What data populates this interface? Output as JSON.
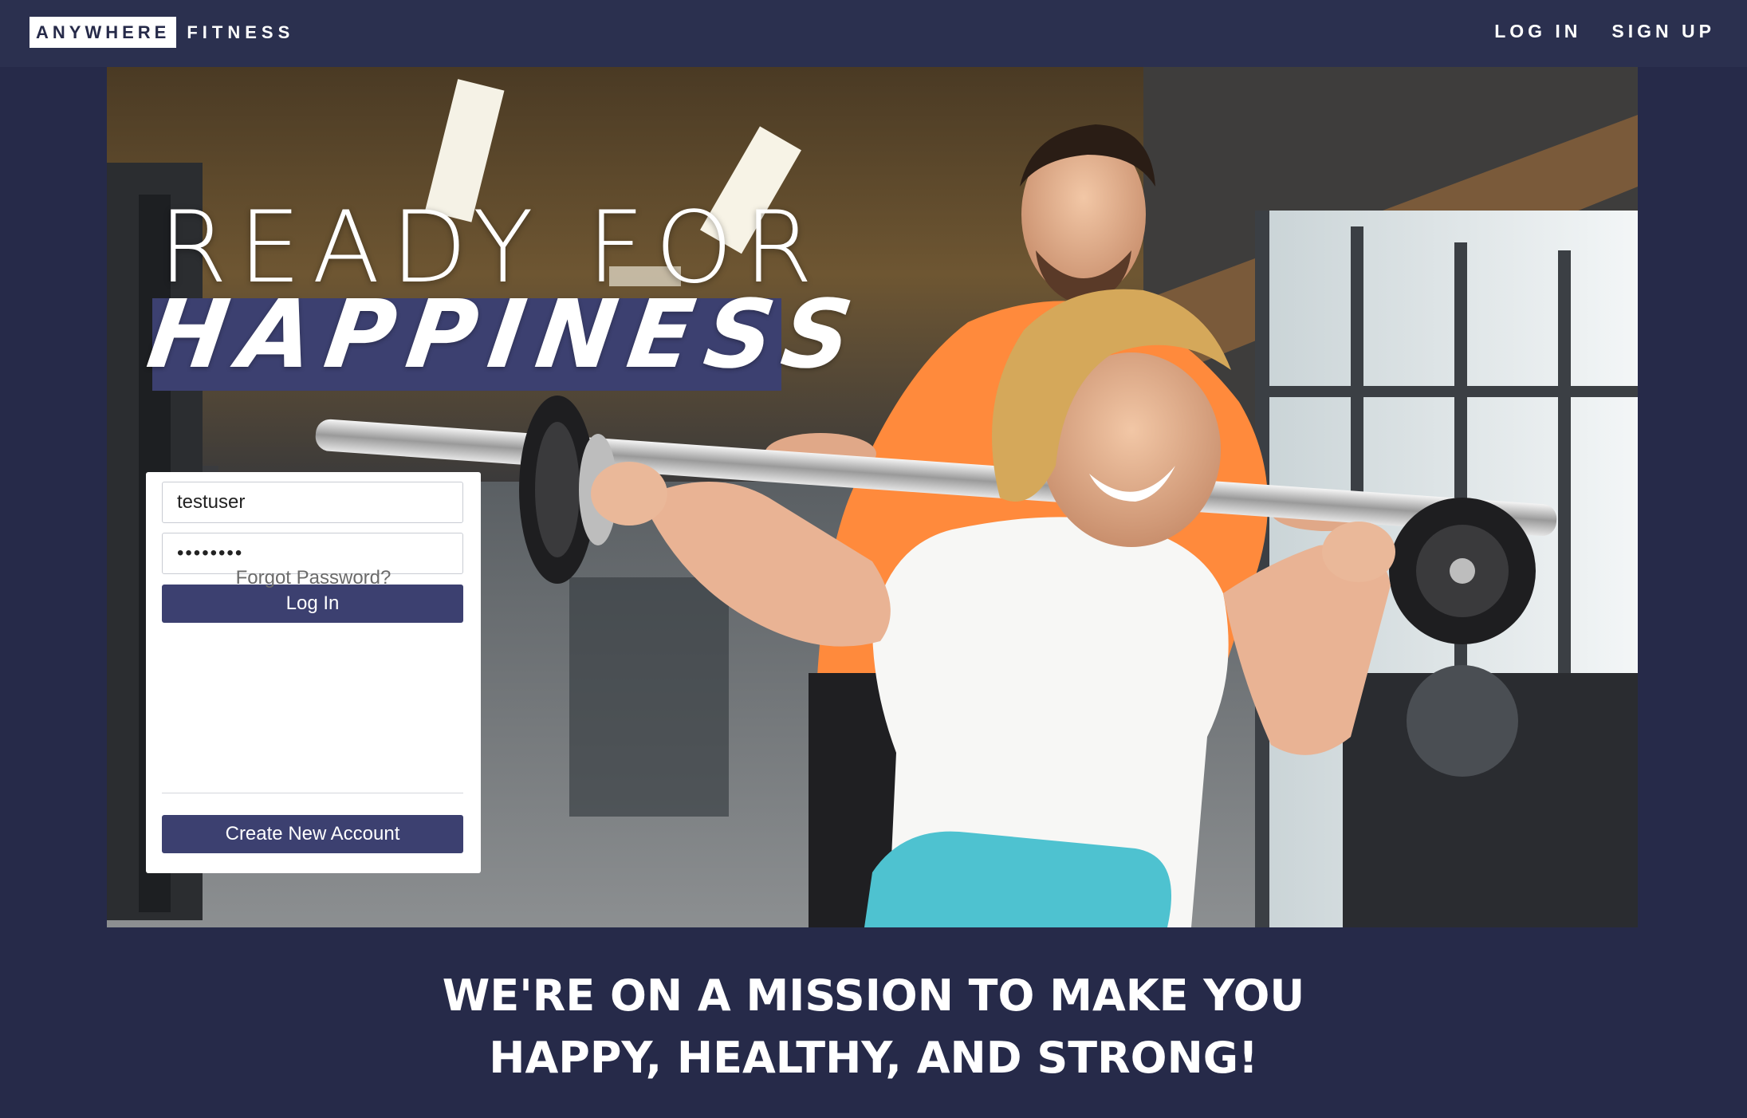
{
  "header": {
    "logo_box_text": "ANYWHERE",
    "logo_text": "FITNESS",
    "nav": {
      "login_label": "LOG IN",
      "signup_label": "SIGN UP"
    }
  },
  "hero": {
    "headline_line1": "READY FOR",
    "headline_line2": "HAPPINESS",
    "image_description_icon": "gym-photo"
  },
  "login_form": {
    "username_value": "testuser",
    "password_value": "••••••••",
    "login_button_label": "Log In",
    "forgot_password_label": "Forgot Password?",
    "create_account_label": "Create New Account"
  },
  "mission": {
    "line1": "WE'RE ON A MISSION TO MAKE YOU",
    "line2": "HAPPY, HEALTHY, AND STRONG!"
  },
  "colors": {
    "page_bg": "#262a49",
    "header_bg": "#2b304f",
    "accent": "#3c4070",
    "white": "#ffffff"
  }
}
